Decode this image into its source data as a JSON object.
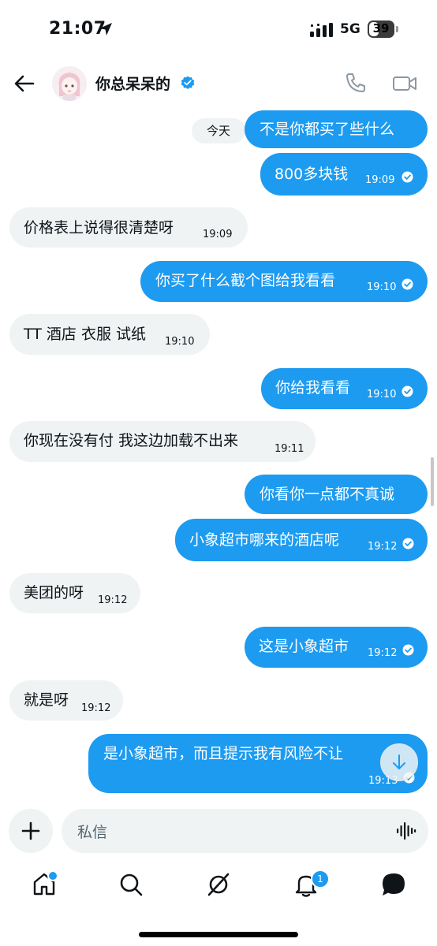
{
  "status_bar": {
    "time": "21:07",
    "network": "5G",
    "battery": "39"
  },
  "header": {
    "contact_name": "你总呆呆的"
  },
  "chat": {
    "day_label": "今天",
    "messages": [
      {
        "dir": "out",
        "text": "不是你都买了些什么",
        "time": ""
      },
      {
        "dir": "out",
        "text": "800多块钱",
        "time": "19:09"
      },
      {
        "dir": "in",
        "text": "价格表上说得很清楚呀",
        "time": "19:09"
      },
      {
        "dir": "out",
        "text": "你买了什么截个图给我看看",
        "time": "19:10"
      },
      {
        "dir": "in",
        "text": "TT 酒店 衣服 试纸",
        "time": "19:10"
      },
      {
        "dir": "out",
        "text": "你给我看看",
        "time": "19:10"
      },
      {
        "dir": "in",
        "text": "你现在没有付 我这边加载不出来",
        "time": "19:11"
      },
      {
        "dir": "out",
        "text": "你看你一点都不真诚",
        "time": ""
      },
      {
        "dir": "out",
        "text": "小象超市哪来的酒店呢",
        "time": "19:12"
      },
      {
        "dir": "in",
        "text": "美团的呀",
        "time": "19:12"
      },
      {
        "dir": "out",
        "text": "这是小象超市",
        "time": "19:12"
      },
      {
        "dir": "in",
        "text": "就是呀",
        "time": "19:12"
      },
      {
        "dir": "out",
        "text": "是小象超市，而且提示我有风险不让",
        "time": "19:13"
      }
    ]
  },
  "composer": {
    "placeholder": "私信"
  },
  "tabbar": {
    "notification_count": "1"
  },
  "colors": {
    "accent": "#1d9bf0",
    "incoming_bubble": "#eff3f4",
    "text": "#0f1419"
  }
}
